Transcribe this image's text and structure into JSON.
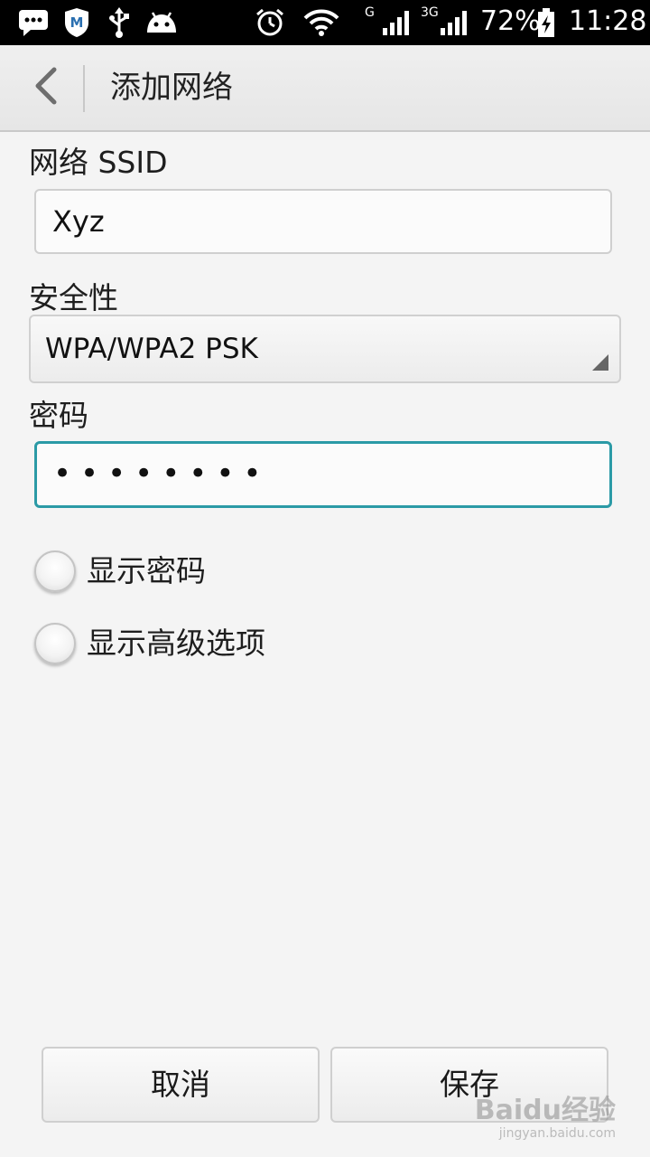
{
  "status_bar": {
    "battery": "72%",
    "time": "11:28",
    "network_1": "G",
    "network_2": "3G"
  },
  "action_bar": {
    "title": "添加网络"
  },
  "form": {
    "ssid_label": "网络 SSID",
    "ssid_value": "Xyz",
    "security_label": "安全性",
    "security_value": "WPA/WPA2 PSK",
    "password_label": "密码",
    "password_value": "••••••••",
    "show_password_label": "显示密码",
    "show_password_checked": false,
    "advanced_label": "显示高级选项",
    "advanced_checked": false
  },
  "buttons": {
    "cancel": "取消",
    "save": "保存"
  },
  "watermark": {
    "main": "Baidu经验",
    "sub": "jingyan.baidu.com"
  },
  "colors": {
    "focus_accent": "#2b9aa6",
    "background": "#f4f4f4"
  }
}
